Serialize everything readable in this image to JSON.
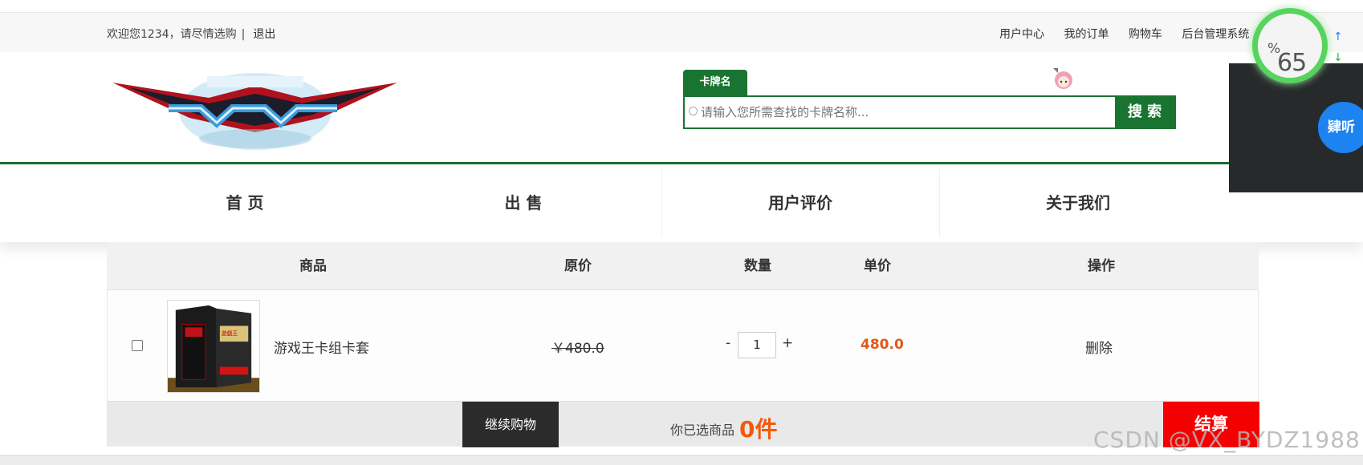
{
  "topbar": {
    "welcome": "欢迎您1234，请尽情选购",
    "separator": "|",
    "logout": "退出",
    "links": [
      "用户中心",
      "我的订单",
      "购物车",
      "后台管理系统"
    ]
  },
  "header": {
    "logo_alt": "yugioh-vrains-logo",
    "search_tab": "卡牌名",
    "search_placeholder": "请输入您所需查找的卡牌名称...",
    "search_button": "搜 索"
  },
  "nav": [
    "首 页",
    "出 售",
    "用户评价",
    "关于我们"
  ],
  "cart": {
    "headers": [
      "商品",
      "原价",
      "数量",
      "单价",
      "操作"
    ],
    "items": [
      {
        "name": "游戏王卡组卡套",
        "original_price": "￥480.0",
        "quantity": "1",
        "unit_price": "480.0",
        "action": "删除"
      }
    ],
    "quantity_minus": "-",
    "quantity_plus": "+",
    "continue_button": "继续购物",
    "selected_label": "你已选商品",
    "selected_count": "0件",
    "checkout_button": "结算"
  },
  "overlays": {
    "gauge_value": "65",
    "gauge_unit": "%",
    "listen_button": "肄听",
    "watermark": "CSDN @VX_BYDZ1988"
  },
  "colors": {
    "brand_green": "#1a7431",
    "price_orange": "#e05a17",
    "checkout_red": "#f50000",
    "listen_blue": "#1d83f0"
  }
}
